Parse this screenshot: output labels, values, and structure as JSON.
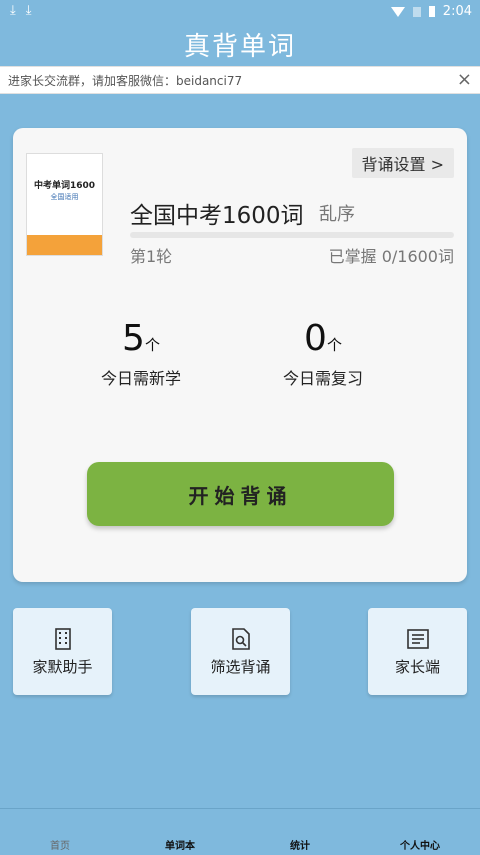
{
  "status_bar": {
    "time": "2:04"
  },
  "app_title": "真背单词",
  "notice": {
    "text": "进家长交流群，请加客服微信：beidanci77",
    "close_symbol": "×"
  },
  "book": {
    "cover_title": "中考单词1600",
    "cover_subtitle": "全国适用",
    "name": "全国中考1600词",
    "order": "乱序",
    "round": "第1轮",
    "mastered": "已掌握 0/1600词",
    "progress_fraction": 0
  },
  "settings_label": "背诵设置 >",
  "stats": {
    "new": {
      "value": "5",
      "unit": "个",
      "label": "今日需新学"
    },
    "review": {
      "value": "0",
      "unit": "个",
      "label": "今日需复习"
    }
  },
  "start_label": "开始背诵",
  "tiles": {
    "assistant": {
      "label": "家默助手",
      "icon": "building-icon"
    },
    "filter": {
      "label": "筛选背诵",
      "icon": "document-search-icon"
    },
    "parent": {
      "label": "家长端",
      "icon": "text-document-icon"
    }
  },
  "nav": {
    "home": "首页",
    "wordbook": "单词本",
    "stats": "统计",
    "profile": "个人中心"
  },
  "colors": {
    "background": "#7fb9dd",
    "accent_green": "#7cb342",
    "cover_orange": "#f4a23a"
  }
}
